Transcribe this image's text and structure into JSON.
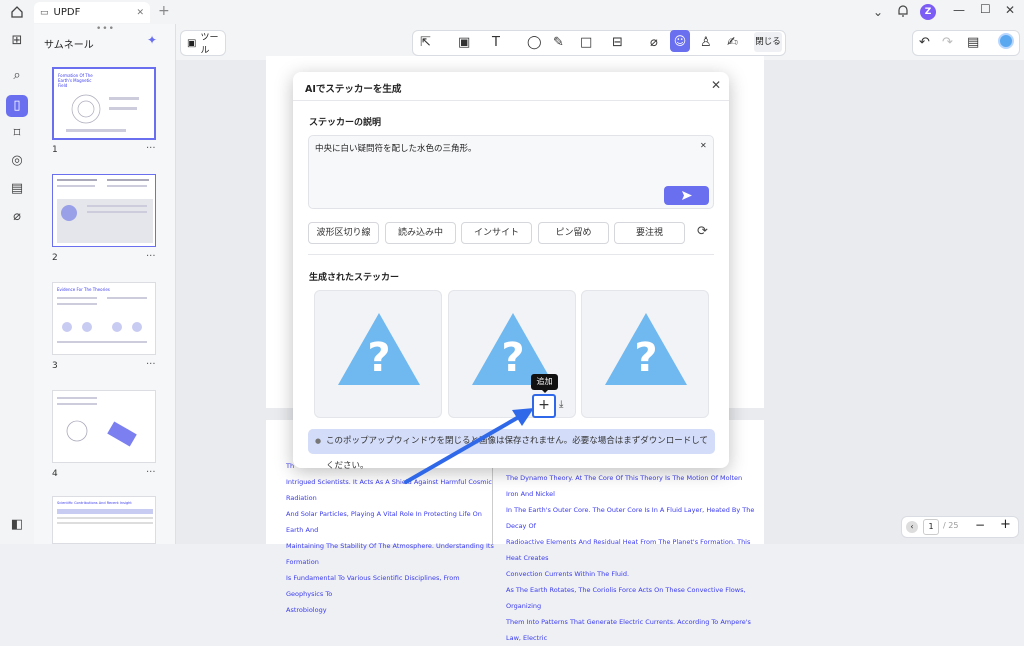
{
  "app": {
    "tab_title": "UPDF",
    "avatar_letter": "Z"
  },
  "thumbnails": {
    "title": "サムネール",
    "pages": [
      "1",
      "2",
      "3",
      "4"
    ],
    "thumb_titles": [
      "Formation Of The Earth's Magnetic Field",
      "",
      "Evidence For The Theories",
      "Scientific Contributions And Recent Insight"
    ]
  },
  "toolbar": {
    "tools_label": "ツール",
    "close_label": "閉じる"
  },
  "modal": {
    "title": "AIでステッカーを生成",
    "desc_label": "ステッカーの説明",
    "desc_value": "中央に白い疑問符を配した水色の三角形。",
    "chips": [
      "波形区切り線",
      "読み込み中",
      "インサイト",
      "ピン留め",
      "要注視"
    ],
    "generated_label": "生成されたステッカー",
    "tooltip": "追加",
    "notice": "このポップアップウィンドウを閉じると画像は保存されません。必要な場合はまずダウンロードしてください。"
  },
  "pdf": {
    "left_lines": [
      "Th",
      "Intrigued Scientists. It Acts As A Shield Against Harmful Cosmic Radiation",
      "And Solar Particles, Playing A Vital Role In Protecting Life On Earth And",
      "Maintaining The Stability Of The Atmosphere. Understanding Its Formation",
      "Is Fundamental To Various Scientific Disciplines, From Geophysics To",
      "Astrobiology"
    ],
    "right_lines": [
      "The Dynamo Theory. At The Core Of This Theory Is The Motion Of Molten Iron And Nickel",
      "In The Earth's Outer Core. The Outer Core Is In A Fluid Layer, Heated By The Decay Of",
      "Radioactive Elements And Residual Heat From The Planet's Formation. This Heat Creates",
      "Convection Currents Within The Fluid.",
      "As The Earth Rotates, The Coriolis Force Acts On These Convective Flows, Organizing",
      "Them Into Patterns That Generate Electric Currents. According To Ampere's Law, Electric"
    ]
  },
  "pager": {
    "current": "1",
    "total": "/ 25"
  },
  "colors": {
    "accent": "#6a6ff0",
    "sticker": "#6fb8f0",
    "arrow": "#2f68e8"
  }
}
